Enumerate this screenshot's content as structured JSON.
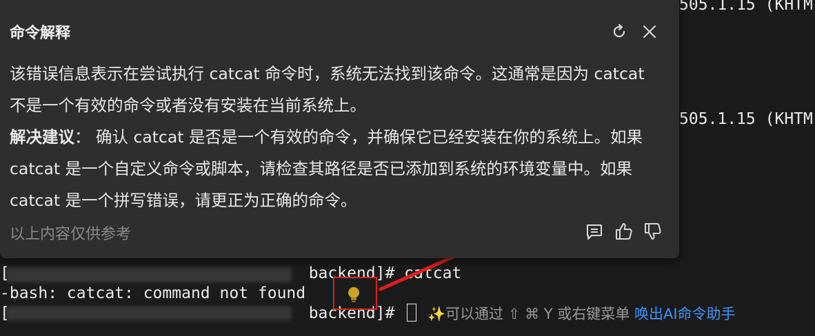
{
  "popup": {
    "title": "命令解释",
    "paragraph1": "该错误信息表示在尝试执行 catcat 命令时，系统无法找到该命令。这通常是因为 catcat 不是一个有效的命令或者没有安装在当前系统上。",
    "suggestion_label": "解决建议",
    "suggestion_sep": "：",
    "suggestion_text": " 确认 catcat 是否是一个有效的命令，并确保它已经安装在你的系统上。如果 catcat 是一个自定义命令或脚本，请检查其路径是否已添加到系统的环境变量中。如果 catcat 是一个拼写错误，请更正为正确的命令。",
    "footer": "以上内容仅供参考"
  },
  "terminal": {
    "right_fragment_1": "505.1.15 (KHTM",
    "right_fragment_2": "505.1.15 (KHTM",
    "line1_suffix": " backend]# catcat",
    "line2": "-bash: catcat: command not found",
    "line3_suffix": " backend]#",
    "hint_prefix": "✨可以通过 ⇧ ⌘ Y 或右键菜单 ",
    "hint_link": "唤出AI命令助手"
  },
  "colors": {
    "annotation": "#e01f1f",
    "link": "#3a94ff",
    "bulb": "#c9a227"
  }
}
